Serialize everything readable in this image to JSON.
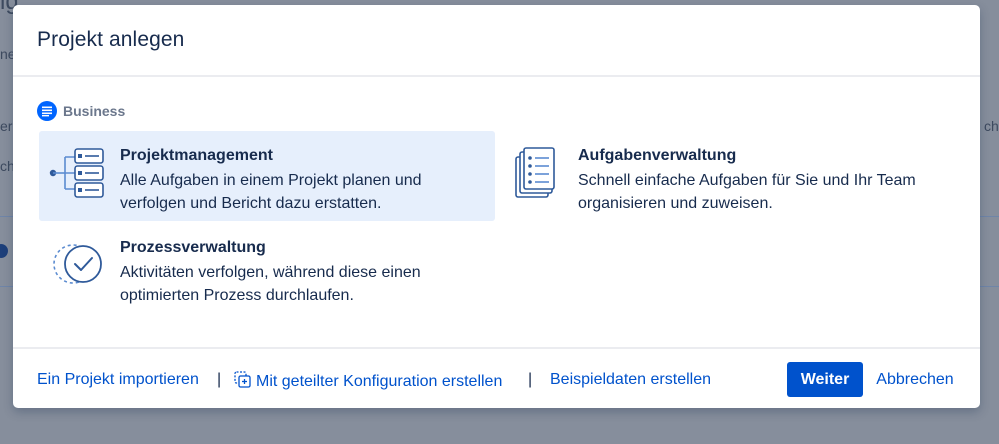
{
  "dialog": {
    "title": "Projekt anlegen",
    "section_label": "Business",
    "cards": [
      {
        "title": "Projektmanagement",
        "description": "Alle Aufgaben in einem Projekt planen und verfolgen und Bericht dazu erstatten.",
        "icon": "project-management-icon",
        "selected": true
      },
      {
        "title": "Aufgabenverwaltung",
        "description": "Schnell einfache Aufgaben für Sie und Ihr Team organisieren und zuweisen.",
        "icon": "task-management-icon",
        "selected": false
      },
      {
        "title": "Prozessverwaltung",
        "description": "Aktivitäten verfolgen, während diese einen optimierten Prozess durchlaufen.",
        "icon": "process-management-icon",
        "selected": false
      }
    ]
  },
  "footer": {
    "import_link": "Ein Projekt importieren",
    "separator": "|",
    "shared_config_link": "Mit geteilter Konfiguration erstellen",
    "sample_data_link": "Beispieldaten erstellen",
    "next_button": "Weiter",
    "cancel_button": "Abbrechen"
  },
  "colors": {
    "primary": "#0052cc",
    "selected_card": "#e6effc",
    "text": "#172b4d",
    "subtle_text": "#6b778c"
  }
}
